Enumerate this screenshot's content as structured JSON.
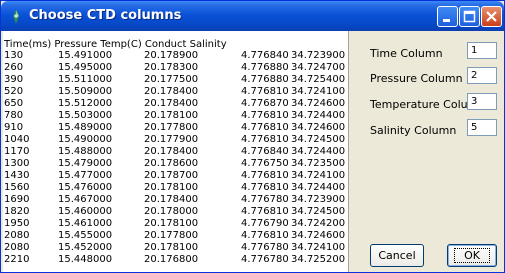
{
  "window": {
    "title": "Choose CTD columns"
  },
  "table": {
    "header": "Time(ms) Pressure Temp(C) Conduct Salinity",
    "rows": [
      [
        "130",
        "15.491000",
        "20.178900",
        "4.776840",
        "34.723900"
      ],
      [
        "260",
        "15.495000",
        "20.178300",
        "4.776880",
        "34.724700"
      ],
      [
        "390",
        "15.511000",
        "20.177500",
        "4.776880",
        "34.725400"
      ],
      [
        "520",
        "15.509000",
        "20.178400",
        "4.776810",
        "34.724100"
      ],
      [
        "650",
        "15.512000",
        "20.178400",
        "4.776870",
        "34.724600"
      ],
      [
        "780",
        "15.503000",
        "20.178100",
        "4.776810",
        "34.724400"
      ],
      [
        "910",
        "15.489000",
        "20.177800",
        "4.776810",
        "34.724600"
      ],
      [
        "1040",
        "15.490000",
        "20.177900",
        "4.776810",
        "34.724500"
      ],
      [
        "1170",
        "15.488000",
        "20.178400",
        "4.776840",
        "34.724400"
      ],
      [
        "1300",
        "15.479000",
        "20.178600",
        "4.776750",
        "34.723500"
      ],
      [
        "1430",
        "15.477000",
        "20.178700",
        "4.776810",
        "34.724100"
      ],
      [
        "1560",
        "15.476000",
        "20.178100",
        "4.776810",
        "34.724400"
      ],
      [
        "1690",
        "15.467000",
        "20.178400",
        "4.776780",
        "34.723900"
      ],
      [
        "1820",
        "15.460000",
        "20.178000",
        "4.776810",
        "34.724500"
      ],
      [
        "1950",
        "15.461000",
        "20.178100",
        "4.776790",
        "34.724200"
      ],
      [
        "2080",
        "15.455000",
        "20.177800",
        "4.776810",
        "34.724600"
      ],
      [
        "2080",
        "15.452000",
        "20.178100",
        "4.776780",
        "34.724100"
      ],
      [
        "2210",
        "15.448000",
        "20.176800",
        "4.776780",
        "34.725200"
      ]
    ]
  },
  "fields": {
    "time": {
      "label": "Time Column",
      "value": "1"
    },
    "pressure": {
      "label": "Pressure Column",
      "value": "2"
    },
    "temperature": {
      "label": "Temperature Column",
      "value": "3"
    },
    "salinity": {
      "label": "Salinity Column",
      "value": "5"
    }
  },
  "buttons": {
    "cancel": "Cancel",
    "ok": "OK"
  },
  "icons": {
    "app": "app-icon",
    "minimize": "minimize-icon",
    "maximize": "maximize-icon",
    "close": "close-icon"
  },
  "colors": {
    "titlebar": "#0a52d8",
    "close": "#c8401b",
    "face": "#ece9d8"
  }
}
